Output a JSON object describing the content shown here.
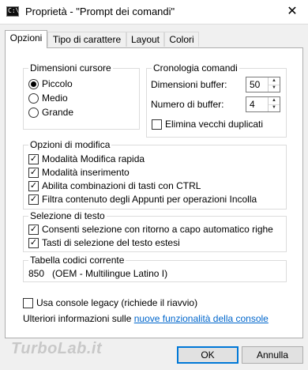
{
  "window": {
    "icon_text": "C:\\",
    "title": "Proprietà - \"Prompt dei comandi\"",
    "close_glyph": "✕"
  },
  "tabs": [
    "Opzioni",
    "Tipo di carattere",
    "Layout",
    "Colori"
  ],
  "cursor_size": {
    "title": "Dimensioni cursore",
    "options": [
      "Piccolo",
      "Medio",
      "Grande"
    ],
    "selected": "Piccolo"
  },
  "history": {
    "title": "Cronologia comandi",
    "buffer_size_label": "Dimensioni buffer:",
    "buffer_size_value": "50",
    "buffer_count_label": "Numero di buffer:",
    "buffer_count_value": "4",
    "discard_duplicates_label": "Elimina vecchi duplicati",
    "discard_duplicates_checked": false
  },
  "edit_options": {
    "title": "Opzioni di modifica",
    "items": [
      {
        "label": "Modalità Modifica rapida",
        "checked": true
      },
      {
        "label": "Modalità inserimento",
        "checked": true
      },
      {
        "label": "Abilita combinazioni di tasti con CTRL",
        "checked": true
      },
      {
        "label": "Filtra contenuto degli Appunti per operazioni Incolla",
        "checked": true
      }
    ]
  },
  "text_selection": {
    "title": "Selezione di testo",
    "items": [
      {
        "label": "Consenti selezione con ritorno a capo automatico righe",
        "checked": true
      },
      {
        "label": "Tasti di selezione del testo estesi",
        "checked": true
      }
    ]
  },
  "codepage": {
    "title": "Tabella codici corrente",
    "value": "850   (OEM - Multilingue Latino I)"
  },
  "legacy": {
    "label": "Usa console legacy (richiede il riavvio)",
    "checked": false
  },
  "more_info": {
    "prefix": "Ulteriori informazioni sulle",
    "link": "nuove funzionalità della console"
  },
  "buttons": {
    "ok": "OK",
    "cancel": "Annulla"
  },
  "watermark": "TurboLab.it"
}
